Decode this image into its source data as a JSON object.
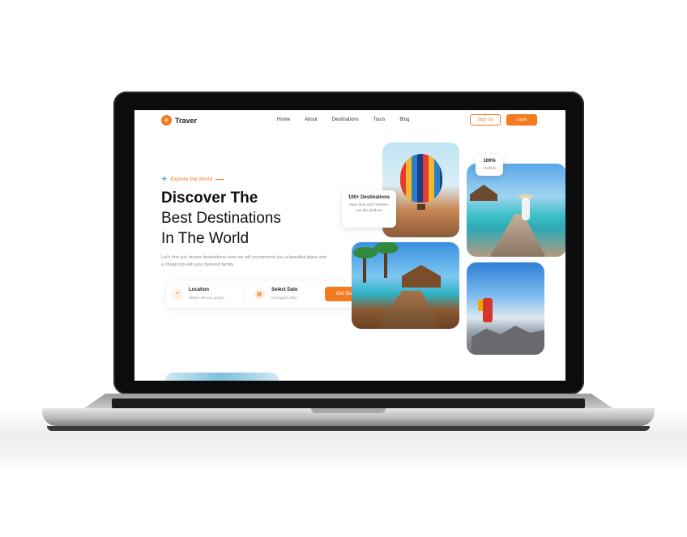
{
  "nav": {
    "brand": "Traver",
    "links": [
      "Home",
      "About",
      "Destinations",
      "Tours",
      "Blog"
    ],
    "signup_label": "Sign Up",
    "login_label": "Login"
  },
  "hero": {
    "tagline": "Explore the World",
    "heading_line1": "Discover The",
    "heading_line2": "Best Destinations",
    "heading_line3": "In The World",
    "description": "Let's find you dream destinations here we will recommend you a beautiful place and a cheap trip with your beloved family."
  },
  "search": {
    "location_title": "Location",
    "location_sub": "Where are you going?",
    "date_title": "Select Date",
    "date_sub": "03 August 2022",
    "cta_label": "Get Started"
  },
  "badges": {
    "destinations_title": "100+ Destinations",
    "destinations_sub": "More than 100 Travelers use this platform",
    "verified_title": "100%",
    "verified_sub": "Verified"
  },
  "colors": {
    "accent": "#f47a20",
    "text": "#111111"
  }
}
